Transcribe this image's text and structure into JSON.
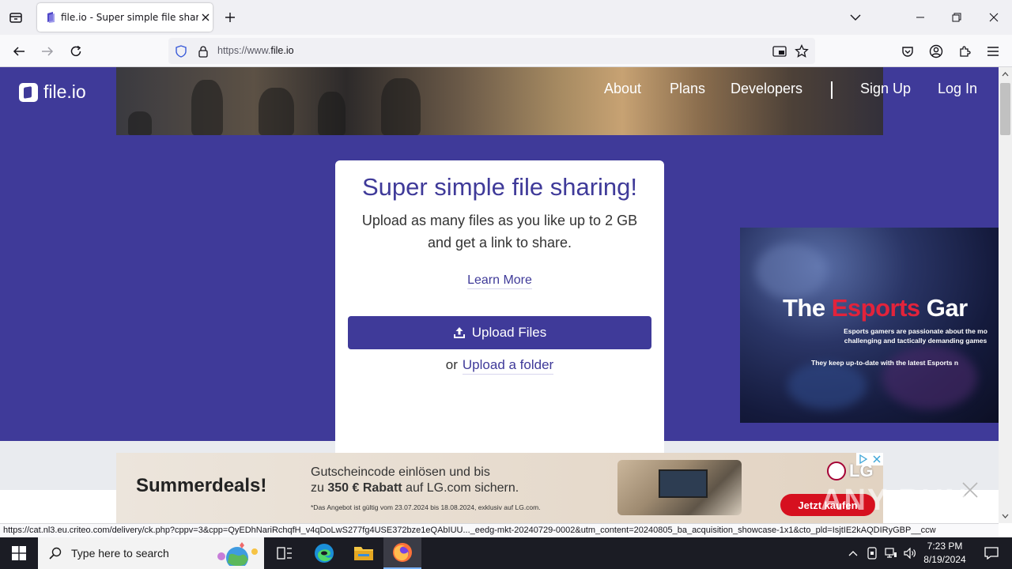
{
  "browser": {
    "tab": {
      "title": "file.io - Super simple file sharing"
    },
    "url": {
      "prefix": "https://www.",
      "domain": "file.io"
    },
    "status_url": "https://cat.nl3.eu.criteo.com/delivery/ck.php?cppv=3&cpp=QyEDhNariRchqfH_v4qDoLwS277fg4USE372bze1eQAbIUU..._eedg-mkt-20240729-0002&utm_content=20240805_ba_acquisition_showcase-1x1&cto_pld=IsjtIE2kAQDIRyGBP__ccw"
  },
  "site": {
    "logo_text": "file.io",
    "nav": {
      "about": "About",
      "plans": "Plans",
      "developers": "Developers",
      "signup": "Sign Up",
      "login": "Log In"
    },
    "card": {
      "title": "Super simple file sharing!",
      "subtitle_line1": "Upload as many files as you like up to 2 GB",
      "subtitle_line2": "and get a link to share.",
      "learn_more": "Learn More",
      "upload_button": "Upload Files",
      "or": "or",
      "upload_folder": "Upload a folder"
    },
    "side_ad": {
      "title_part1": "The ",
      "title_highlight": "Esports",
      "title_part2": " Gar",
      "text_line1": "Esports gamers are passionate about the mo",
      "text_line2": "challenging and tactically demanding games",
      "text_line3": "They keep up-to-date with the latest Esports n"
    },
    "bottom_ad": {
      "headline": "Summerdeals!",
      "line1": "Gutscheincode einlösen und bis",
      "line2_pre": "zu ",
      "line2_bold": "350 € Rabatt",
      "line2_post": " auf LG.com sichern.",
      "fine_print": "*Das Angebot ist gültig vom 23.07.2024 bis 18.08.2024, exklusiv auf LG.com.",
      "brand": "LG",
      "cta": "Jetzt kaufen"
    },
    "watermark": "ANY RUN"
  },
  "taskbar": {
    "search_placeholder": "Type here to search",
    "time": "7:23 PM",
    "date": "8/19/2024"
  },
  "colors": {
    "brand": "#3f3a99",
    "ad_red": "#e2233b"
  }
}
